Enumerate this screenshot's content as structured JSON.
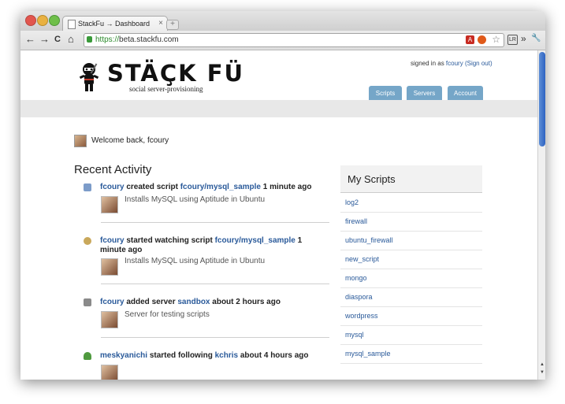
{
  "browser": {
    "tab_title": "StackFu → Dashboard",
    "tab_close": "×",
    "new_tab": "+",
    "url_scheme": "https://",
    "url_rest": "beta.stackfu.com",
    "nav": {
      "back": "←",
      "forward": "→",
      "reload": "C",
      "home": "⌂"
    },
    "overflow": "»",
    "wrench": "🔧",
    "pdf_label": "A",
    "star": "☆",
    "lr_label": "LR"
  },
  "header": {
    "brand": "STÄÇK FÜ",
    "tagline": "social server-provisioning",
    "signed_in_prefix": "signed in as ",
    "username": "fcoury",
    "sign_out": "(Sign out)",
    "nav_tabs": [
      "Scripts",
      "Servers",
      "Account"
    ]
  },
  "welcome": {
    "text": "Welcome back, fcoury"
  },
  "recent_activity": {
    "title": "Recent Activity",
    "items": [
      {
        "icon": "script-icon",
        "user": "fcoury",
        "verb": " created script ",
        "target": "fcoury/mysql_sample",
        "time": " 1 minute ago",
        "desc": "Installs MySQL using Aptitude in Ubuntu"
      },
      {
        "icon": "watch-icon",
        "user": "fcoury",
        "verb": " started watching script ",
        "target": "fcoury/mysql_sample",
        "time": " 1 minute ago",
        "desc": "Installs MySQL using Aptitude in Ubuntu"
      },
      {
        "icon": "server-icon",
        "user": "fcoury",
        "verb": " added server ",
        "target": "sandbox",
        "time": " about 2 hours ago",
        "desc": "Server for testing scripts"
      },
      {
        "icon": "user-icon",
        "user": "meskyanichi",
        "verb": " started following ",
        "target": "kchris",
        "time": " about 4 hours ago",
        "desc": ""
      }
    ]
  },
  "my_scripts": {
    "title": "My Scripts",
    "items": [
      "log2",
      "firewall",
      "ubuntu_firewall",
      "new_script",
      "mongo",
      "diaspora",
      "wordpress",
      "mysql",
      "mysql_sample"
    ]
  },
  "colors": {
    "link": "#2a5a9a",
    "nav_tab": "#75a6c8",
    "band": "#e8e8e8"
  }
}
